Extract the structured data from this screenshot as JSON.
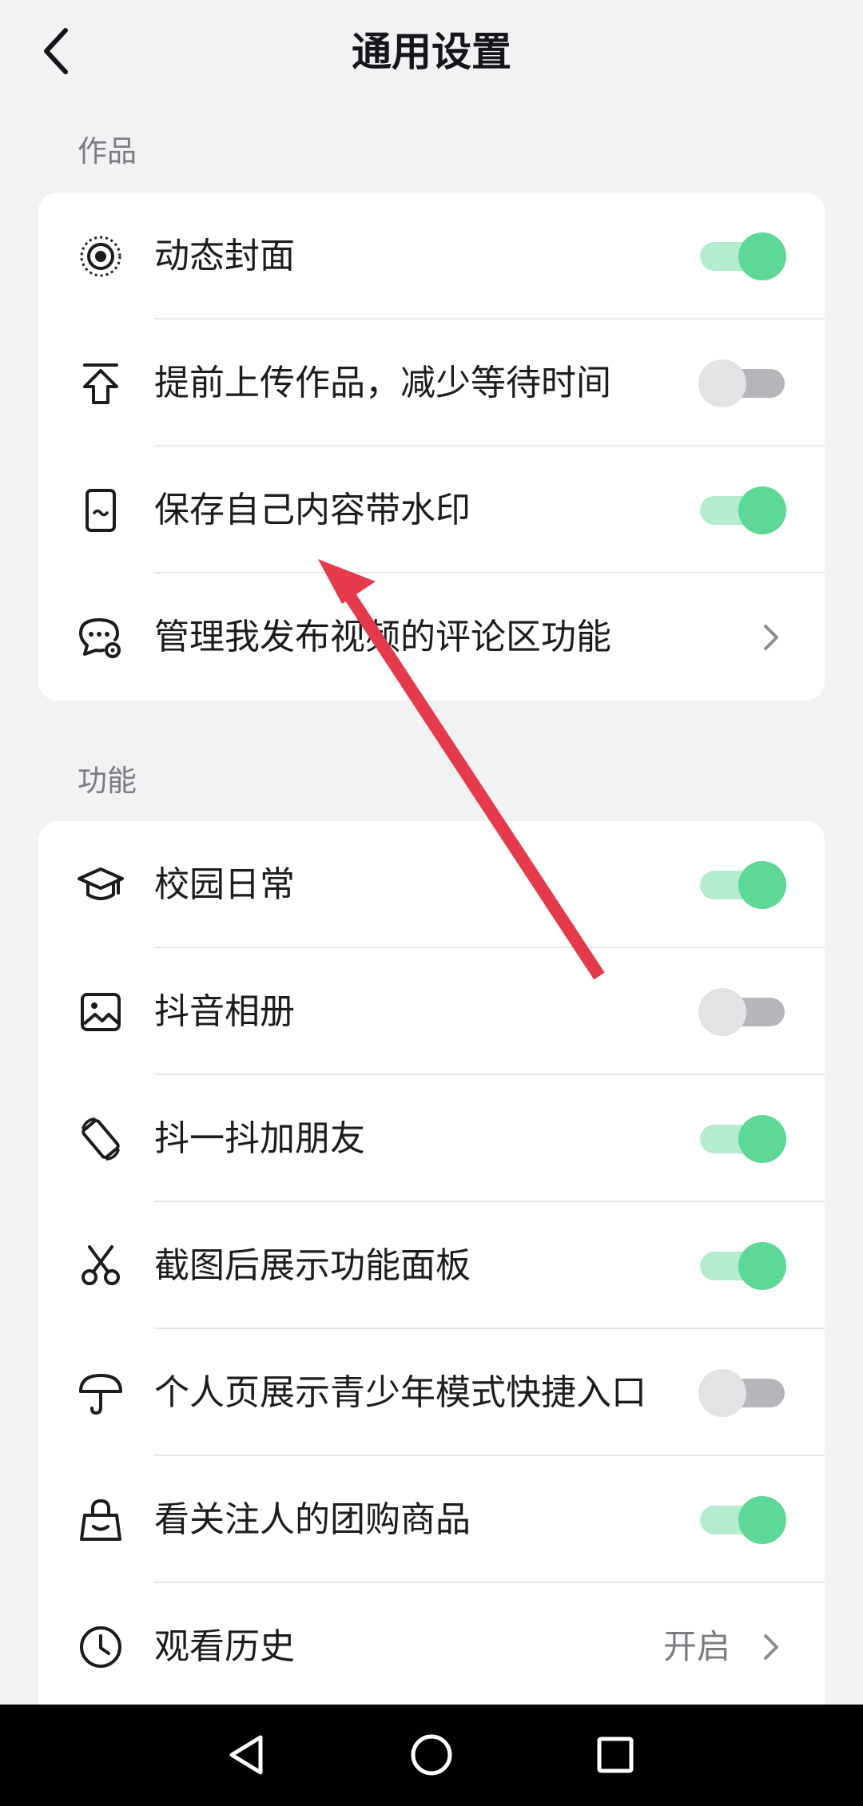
{
  "header": {
    "title": "通用设置",
    "back_icon": "chevron-left-icon"
  },
  "sections": [
    {
      "title": "作品",
      "items": [
        {
          "icon": "dynamic-cover-icon",
          "label": "动态封面",
          "control": "toggle",
          "on": true
        },
        {
          "icon": "upload-icon",
          "label": "提前上传作品，减少等待时间",
          "control": "toggle",
          "on": false
        },
        {
          "icon": "phone-watermark-icon",
          "label": "保存自己内容带水印",
          "control": "toggle",
          "on": true
        },
        {
          "icon": "comment-settings-icon",
          "label": "管理我发布视频的评论区功能",
          "control": "chevron"
        }
      ]
    },
    {
      "title": "功能",
      "items": [
        {
          "icon": "graduation-cap-icon",
          "label": "校园日常",
          "control": "toggle",
          "on": true
        },
        {
          "icon": "image-icon",
          "label": "抖音相册",
          "control": "toggle",
          "on": false
        },
        {
          "icon": "rotate-phone-icon",
          "label": "抖一抖加朋友",
          "control": "toggle",
          "on": true
        },
        {
          "icon": "scissors-icon",
          "label": "截图后展示功能面板",
          "control": "toggle",
          "on": true
        },
        {
          "icon": "umbrella-icon",
          "label": "个人页展示青少年模式快捷入口",
          "control": "toggle",
          "on": false
        },
        {
          "icon": "shopping-bag-icon",
          "label": "看关注人的团购商品",
          "control": "toggle",
          "on": true
        },
        {
          "icon": "clock-icon",
          "label": "观看历史",
          "control": "chevron",
          "value": "开启"
        }
      ]
    }
  ],
  "annotation": {
    "type": "red-arrow",
    "color": "#e43a4b"
  },
  "navbar": {
    "buttons": [
      "back-triangle-icon",
      "home-circle-icon",
      "recents-square-icon"
    ]
  },
  "colors": {
    "toggle_on_track": "#b3ecce",
    "toggle_on_knob": "#5dd896",
    "toggle_off_track": "#b5b5ba",
    "toggle_off_knob": "#e3e3e6",
    "background": "#f2f2f4"
  }
}
